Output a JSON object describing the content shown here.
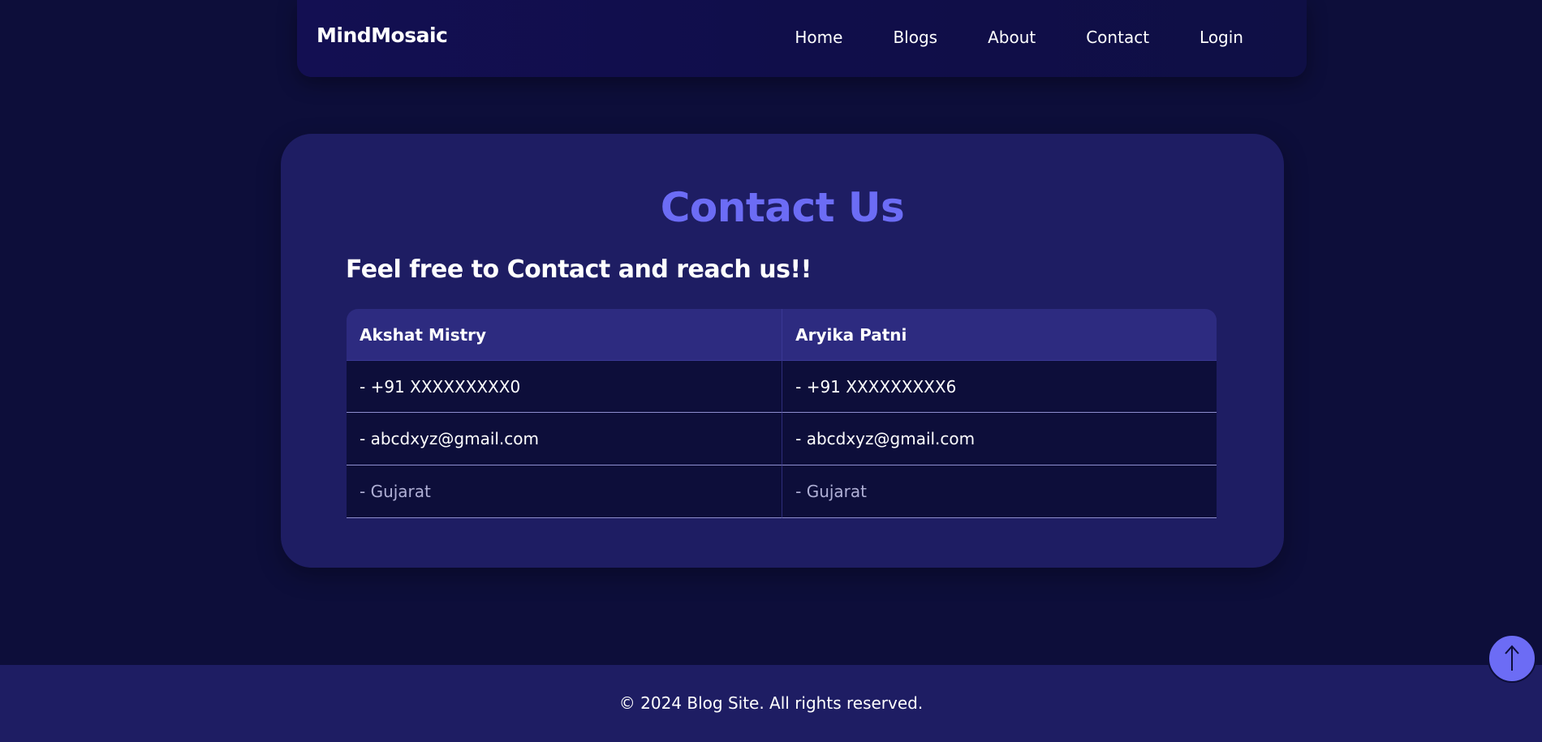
{
  "navbar": {
    "brand": "MindMosaic",
    "links": [
      "Home",
      "Blogs",
      "About",
      "Contact",
      "Login"
    ]
  },
  "contact": {
    "title": "Contact Us",
    "subtitle": "Feel free to Contact and reach us!!",
    "columns": [
      "Akshat Mistry",
      "Aryika Patni"
    ],
    "rows": [
      [
        "- +91 XXXXXXXXX0",
        "- +91 XXXXXXXXX6"
      ],
      [
        "- abcdxyz@gmail.com",
        "- abcdxyz@gmail.com"
      ],
      [
        "- Gujarat",
        "- Gujarat"
      ]
    ]
  },
  "footer": {
    "text": "© 2024 Blog Site. All rights reserved."
  },
  "scroll_top": {
    "icon": "arrow-up-icon"
  },
  "colors": {
    "background": "#0d0e3a",
    "card": "#1e1d63",
    "accent": "#6c6cf5",
    "table_header": "#2d2b80"
  }
}
